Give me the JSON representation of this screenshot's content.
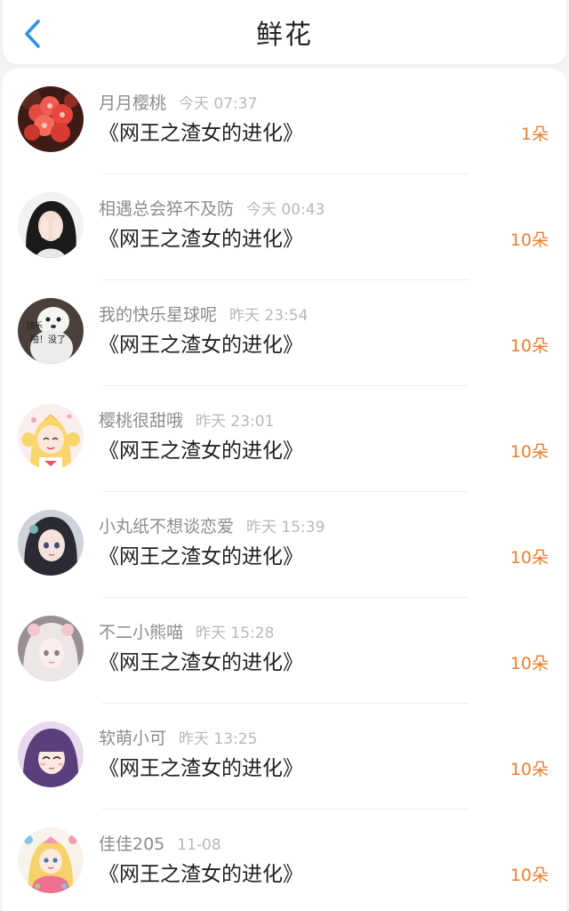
{
  "header": {
    "title": "鲜花"
  },
  "accent": "#f07d2b",
  "records": [
    {
      "name": "月月樱桃",
      "time": "今天 07:37",
      "book": "《网王之渣女的进化》",
      "count": "1朵",
      "avatar": "red-flowers"
    },
    {
      "name": "相遇总会猝不及防",
      "time": "今天 00:43",
      "book": "《网王之渣女的进化》",
      "count": "10朵",
      "avatar": "girl-covering-face"
    },
    {
      "name": "我的快乐星球呢",
      "time": "昨天 23:54",
      "book": "《网王之渣女的进化》",
      "count": "10朵",
      "avatar": "white-dog-meme",
      "avatar_text": [
        "快乐",
        "啪！没了"
      ]
    },
    {
      "name": "樱桃很甜哦",
      "time": "昨天 23:01",
      "book": "《网王之渣女的进化》",
      "count": "10朵",
      "avatar": "sailor-moon"
    },
    {
      "name": "小丸纸不想谈恋爱",
      "time": "昨天 15:39",
      "book": "《网王之渣女的进化》",
      "count": "10朵",
      "avatar": "anime-girl-dark-hair"
    },
    {
      "name": "不二小熊喵",
      "time": "昨天 15:28",
      "book": "《网王之渣女的进化》",
      "count": "10朵",
      "avatar": "pale-anime-girl"
    },
    {
      "name": "软萌小可",
      "time": "昨天 13:25",
      "book": "《网王之渣女的进化》",
      "count": "10朵",
      "avatar": "purple-hair-anime-girl"
    },
    {
      "name": "佳佳205",
      "time": "11-08",
      "book": "《网王之渣女的进化》",
      "count": "10朵",
      "avatar": "colorful-anime-princess"
    }
  ]
}
